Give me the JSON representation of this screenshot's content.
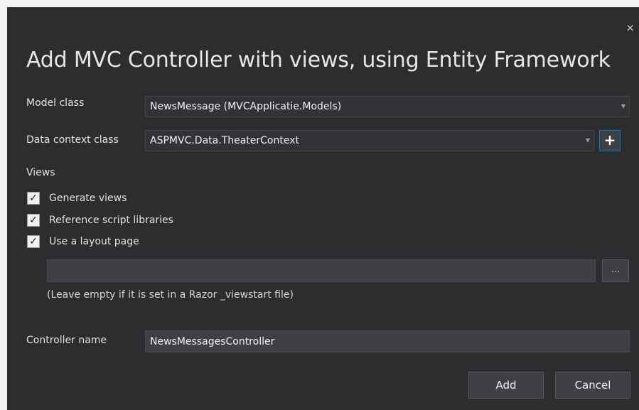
{
  "dialog": {
    "title": "Add MVC Controller with views, using Entity Framework",
    "close_icon": "×"
  },
  "model_class": {
    "label": "Model class",
    "value": "NewsMessage (MVCApplicatie.Models)"
  },
  "data_context_class": {
    "label": "Data context class",
    "value": "ASPMVC.Data.TheaterContext",
    "add_label": "+"
  },
  "views": {
    "heading": "Views",
    "options": [
      {
        "label": "Generate views",
        "checked": true
      },
      {
        "label": "Reference script libraries",
        "checked": true
      },
      {
        "label": "Use a layout page",
        "checked": true
      }
    ],
    "layout_page_value": "",
    "browse_label": "...",
    "hint": "(Leave empty if it is set in a Razor _viewstart file)"
  },
  "controller_name": {
    "label": "Controller name",
    "value": "NewsMessagesController"
  },
  "buttons": {
    "add": "Add",
    "cancel": "Cancel"
  },
  "icons": {
    "caret": "▼",
    "check": "✓"
  },
  "colors": {
    "dialog_bg": "#2d2d30",
    "accent": "#007acc",
    "field_bg": "#3f3f46"
  }
}
